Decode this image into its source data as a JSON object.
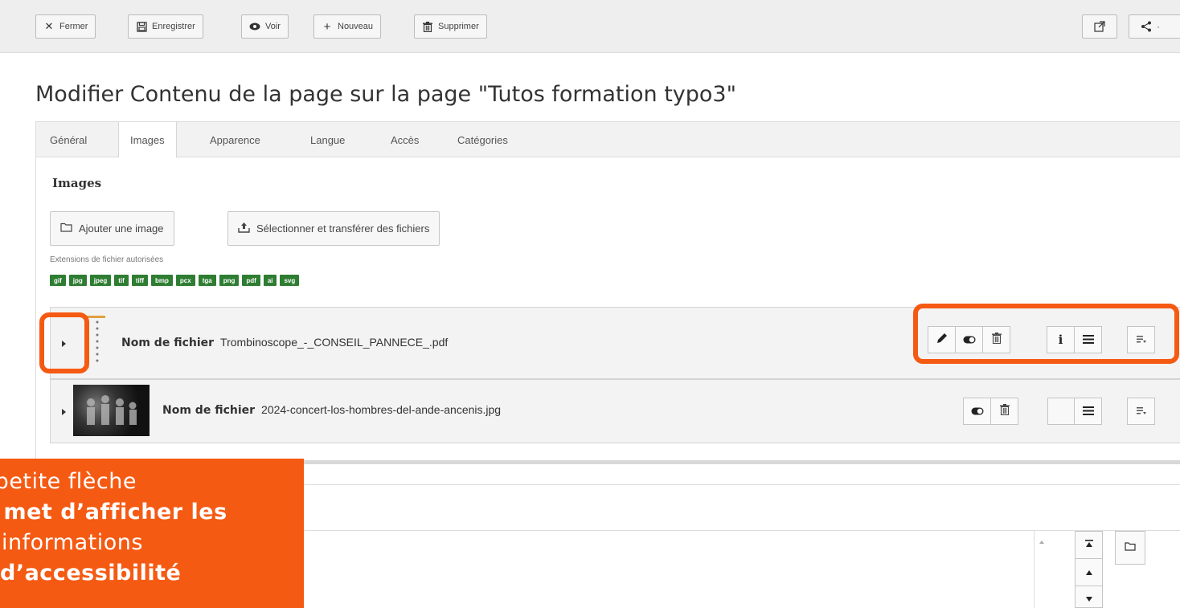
{
  "toolbar": {
    "buttons": [
      {
        "label": "Fermer",
        "icon": "close-icon"
      },
      {
        "label": "Enregistrer",
        "icon": "save-icon"
      },
      {
        "label": "Voir",
        "icon": "eye-icon"
      },
      {
        "label": "Nouveau",
        "icon": "plus-icon"
      },
      {
        "label": "Supprimer",
        "icon": "trash-icon"
      }
    ],
    "right_icons": [
      "open-external-icon",
      "share-icon"
    ]
  },
  "page": {
    "title": "Modifier Contenu de la page sur la page \"Tutos formation typo3\""
  },
  "tabs": [
    {
      "label": "Général",
      "active": false
    },
    {
      "label": "Images",
      "active": true
    },
    {
      "label": "Apparence",
      "active": false
    },
    {
      "label": "Langue",
      "active": false
    },
    {
      "label": "Accès",
      "active": false
    },
    {
      "label": "Catégories",
      "active": false
    }
  ],
  "images_section": {
    "label": "Images",
    "add_button": "Ajouter une image",
    "upload_button": "Sélectionner et transférer des fichiers",
    "extensions_label": "Extensions de fichier autorisées",
    "extensions": [
      "gif",
      "jpg",
      "jpeg",
      "tif",
      "tiff",
      "bmp",
      "pcx",
      "tga",
      "png",
      "pdf",
      "ai",
      "svg"
    ],
    "extension_badge_color": "#2e7d32"
  },
  "files": [
    {
      "label": "Nom de fichier",
      "name": "Trombinoscope_-_CONSEIL_PANNECE_.pdf"
    },
    {
      "label": "Nom de fichier",
      "name": "2024-concert-los-hombres-del-ande-ancenis.jpg"
    }
  ],
  "callout": {
    "line1": "a petite flèche",
    "line2": "met d’afficher les",
    "line3": "informations",
    "line4": "d’accessibilité",
    "color": "#f55a13"
  },
  "highlight_color": "#f55a13"
}
